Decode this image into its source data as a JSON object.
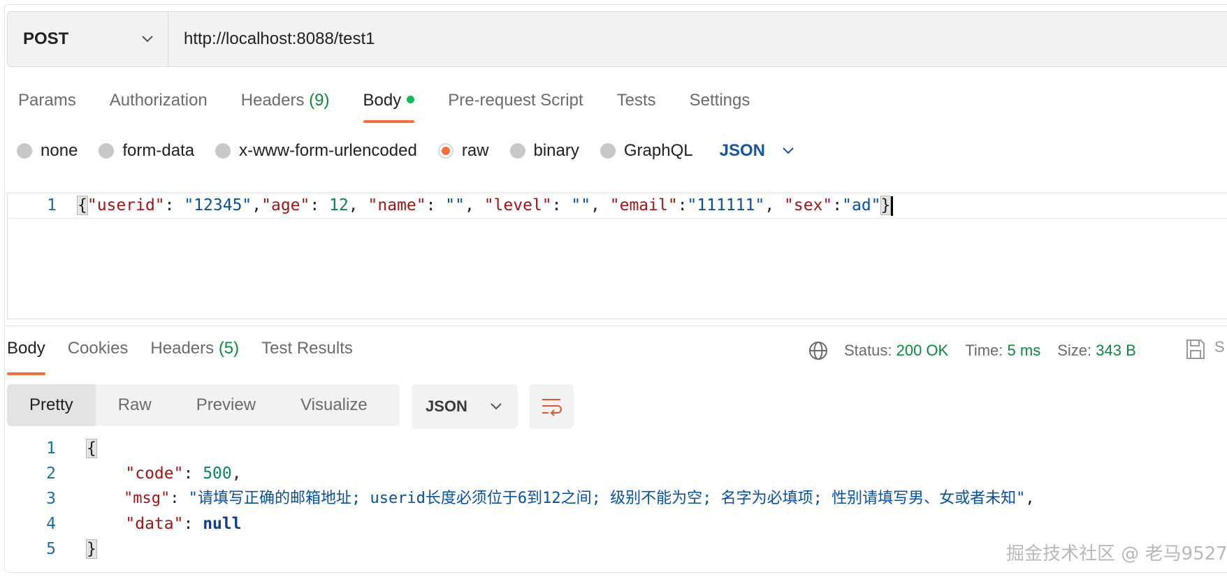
{
  "request": {
    "method": "POST",
    "url": "http://localhost:8088/test1",
    "tabs": [
      {
        "label": "Params"
      },
      {
        "label": "Authorization"
      },
      {
        "label": "Headers",
        "count": "(9)"
      },
      {
        "label": "Body",
        "active": true,
        "indicator": "green-dot"
      },
      {
        "label": "Pre-request Script"
      },
      {
        "label": "Tests"
      },
      {
        "label": "Settings"
      }
    ],
    "body_types": [
      "none",
      "form-data",
      "x-www-form-urlencoded",
      "raw",
      "binary",
      "GraphQL"
    ],
    "selected_body_type": "raw",
    "body_format": "JSON",
    "editor_line_number": "1",
    "body_tokens": {
      "open": "{",
      "userid_key": "\"userid\"",
      "userid_val": "\"12345\"",
      "age_key": "\"age\"",
      "age_val": "12",
      "name_key": "\"name\"",
      "name_val": "\"\"",
      "level_key": "\"level\"",
      "level_val": "\"\"",
      "email_key": "\"email\"",
      "email_val": "\"111111\"",
      "sex_key": "\"sex\"",
      "sex_val": "\"ad\"",
      "close": "}"
    }
  },
  "response": {
    "tabs": [
      {
        "label": "Body",
        "active": true
      },
      {
        "label": "Cookies"
      },
      {
        "label": "Headers",
        "count": "(5)"
      },
      {
        "label": "Test Results"
      }
    ],
    "status_label": "Status:",
    "status_value": "200 OK",
    "time_label": "Time:",
    "time_value": "5 ms",
    "size_label": "Size:",
    "size_value": "343 B",
    "save_partial_text": "S",
    "view_modes": [
      "Pretty",
      "Raw",
      "Preview",
      "Visualize"
    ],
    "active_view": "Pretty",
    "format": "JSON",
    "line_numbers": [
      "1",
      "2",
      "3",
      "4",
      "5"
    ],
    "body": {
      "open": "{",
      "code_key": "\"code\"",
      "code_val": "500",
      "msg_key": "\"msg\"",
      "msg_val": "\"请填写正确的邮箱地址; userid长度必须位于6到12之间; 级别不能为空; 名字为必填项; 性别请填写男、女或者未知\"",
      "data_key": "\"data\"",
      "data_val": "null",
      "close": "}"
    }
  },
  "watermark": "掘金技术社区 @ 老马9527",
  "colors": {
    "accent": "#ff6c37",
    "status_green": "#0b8a3c",
    "json_key": "#a31515",
    "json_string": "#0451a5",
    "json_number": "#098658"
  }
}
